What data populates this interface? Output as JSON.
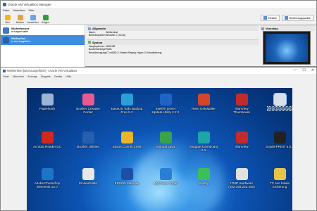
{
  "manager": {
    "title": "Oracle VM VirtualBox Manager",
    "menu": [
      "Datei",
      "Maschine",
      "Hilfe"
    ],
    "toolbar": [
      {
        "label": "Neu",
        "icon": "new-icon",
        "color": "#f6b21a"
      },
      {
        "label": "Ändern",
        "icon": "settings-icon",
        "color": "#e8a23a"
      },
      {
        "label": "Verwerfen",
        "icon": "discard-icon",
        "color": "#6aa4e6"
      },
      {
        "label": "Zeigen",
        "icon": "show-icon",
        "color": "#2f9e3a"
      }
    ],
    "view_buttons": [
      "Details",
      "Sicherungspunkte"
    ],
    "vms": [
      {
        "name": "Wicherfenster",
        "state": "ausgeschaltet"
      },
      {
        "name": "Weißenfest",
        "state": "wird ausgeführt"
      }
    ],
    "sections": {
      "general": {
        "header": "Allgemein",
        "rows": [
          [
            "Name:",
            "Weißenfest"
          ],
          [
            "Betriebssystem:",
            "Windows 7 (32-bit)"
          ]
        ]
      },
      "system": {
        "header": "System",
        "rows": [
          [
            "Hauptspeicher:",
            "4096 MB"
          ],
          [
            "Bootreihenfolge:",
            "Platte"
          ],
          [
            "Beschleunigung:",
            "VT-x/AMD-V, Nested Paging, Hyper-V-Virtualisierung"
          ]
        ]
      },
      "preview": {
        "header": "Vorschau"
      }
    }
  },
  "guest": {
    "title": "Weißenfest [wird ausgeführt] - Oracle VM VirtualBox",
    "menu": [
      "Datei",
      "Maschine",
      "Anzeige",
      "Eingabe",
      "Geräte",
      "Hilfe"
    ],
    "window_controls": [
      "—",
      "☐",
      "✕"
    ],
    "desktop_icons": [
      {
        "label": "Papierkorb",
        "icon": "recycle-bin-icon",
        "color": "#9bb5d4"
      },
      {
        "label": "Brother Creative\nCenter",
        "icon": "brother-creative-icon",
        "color": "#e85a93"
      },
      {
        "label": "EaseUS Todo Backup\nFree 9.2",
        "icon": "easeus-icon",
        "color": "#2a9fd8"
      },
      {
        "label": "Intel(R) Driver\nUpdate Utility 2.2.2",
        "icon": "intel-icon",
        "color": "#1f64c4"
      },
      {
        "label": "Revo Uninstaller",
        "icon": "revo-icon",
        "color": "#d4462a"
      },
      {
        "label": "IrfanView\nThumbnails",
        "icon": "irfanview-thumbs-icon",
        "color": "#c22b2b"
      },
      {
        "label": "Print Conductor",
        "icon": "print-conductor-icon",
        "color": "#e0e6f0"
      },
      {
        "label": "Acrobat Reader DC",
        "icon": "acrobat-icon",
        "color": "#d02a1e"
      },
      {
        "label": "Brother Utilities",
        "icon": "brother-utilities-icon",
        "color": "#2560b0"
      },
      {
        "label": "Epson Connect Sett",
        "icon": "chrome-icon",
        "color": "#e9b52a"
      },
      {
        "label": "Manual Java",
        "icon": "manual-java-icon",
        "color": "#3aa24a"
      },
      {
        "label": "Seagate Dashboard\n2.0",
        "icon": "seagate-icon",
        "color": "#1da6a8"
      },
      {
        "label": "IrfanView",
        "icon": "irfanview-icon",
        "color": "#c22b2b"
      },
      {
        "label": "SpyderPRINT 5.0.2",
        "icon": "spyder-icon",
        "color": "#222222"
      },
      {
        "label": "Adobe Photoshop\nElements 13.0",
        "icon": "photoshop-icon",
        "color": "#1d75c6"
      },
      {
        "label": "Einkaufsliste",
        "icon": "list-icon",
        "color": "#e8e8e8"
      },
      {
        "label": "EPSON Manuals",
        "icon": "epson-manuals-icon",
        "color": "#1d4fa8"
      },
      {
        "label": "MyPhone Portal",
        "icon": "myphone-icon",
        "color": "#2a7fd4"
      },
      {
        "label": "Spotify",
        "icon": "spotify-icon",
        "color": "#3bbf5a"
      },
      {
        "label": "ITMP Hardware\n(192.168.252.250)",
        "icon": "itmp-icon",
        "color": "#e2e2e2"
      },
      {
        "label": "TC.exe lokale\nSicherung",
        "icon": "tc-icon",
        "color": "#e9c24a"
      }
    ]
  }
}
